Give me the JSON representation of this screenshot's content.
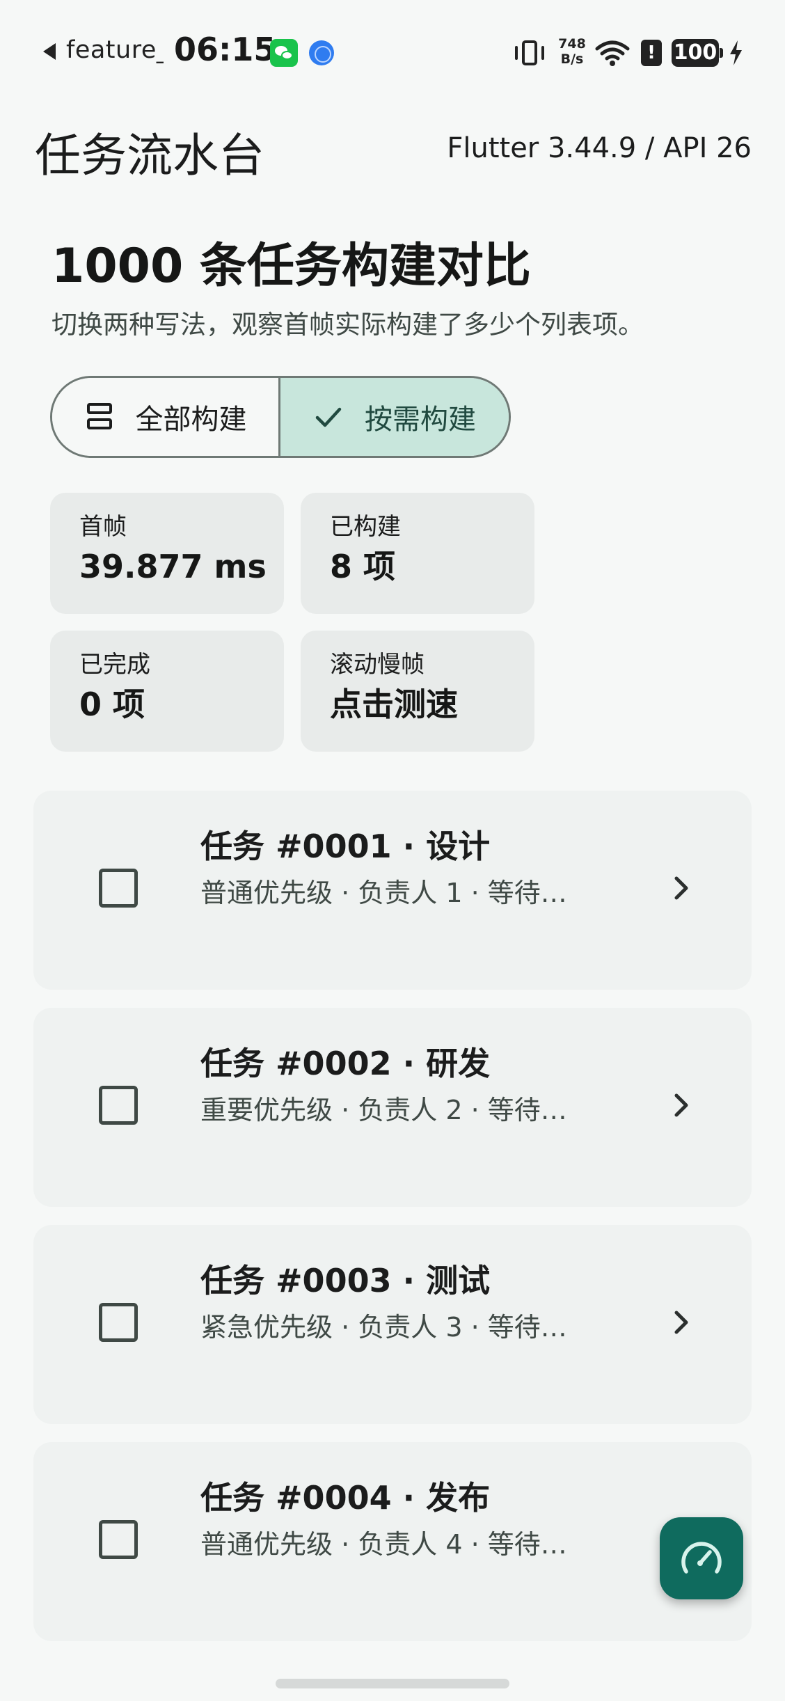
{
  "status_bar": {
    "app_label": "feature_c",
    "time": "06:15",
    "net_speed_top": "748",
    "net_speed_bottom": "B/s",
    "alert_glyph": "!",
    "battery": "100",
    "icons": [
      "back-arrow-icon",
      "wechat-icon",
      "globe-icon",
      "vibrate-icon",
      "wifi-icon",
      "alert-icon",
      "battery-icon",
      "charging-bolt-icon"
    ]
  },
  "appbar": {
    "title": "任务流水台",
    "version": "Flutter 3.44.9 / API 26"
  },
  "header": {
    "headline": "1000 条任务构建对比",
    "subtitle": "切换两种写法，观察首帧实际构建了多少个列表项。"
  },
  "segmented": {
    "options": [
      {
        "label": "全部构建",
        "selected": false,
        "icon": "view-agenda-icon"
      },
      {
        "label": "按需构建",
        "selected": true,
        "icon": "check-icon"
      }
    ]
  },
  "stats": [
    {
      "label": "首帧",
      "value": "39.877 ms"
    },
    {
      "label": "已构建",
      "value": "8 项"
    },
    {
      "label": "已完成",
      "value": "0 项"
    },
    {
      "label": "滚动慢帧",
      "value": "点击测速"
    }
  ],
  "tasks": [
    {
      "title": "任务 #0001 · 设计",
      "meta": "普通优先级 · 负责人 1 · 等待…",
      "done": false
    },
    {
      "title": "任务 #0002 · 研发",
      "meta": "重要优先级 · 负责人 2 · 等待…",
      "done": false
    },
    {
      "title": "任务 #0003 · 测试",
      "meta": "紧急优先级 · 负责人 3 · 等待…",
      "done": false
    },
    {
      "title": "任务 #0004 · 发布",
      "meta": "普通优先级 · 负责人 4 · 等待…",
      "done": false
    }
  ],
  "fab": {
    "icon": "speedometer-icon"
  },
  "colors": {
    "background": "#f6f8f7",
    "card": "#e8ebea",
    "task_card": "#eff2f1",
    "selected_segment": "#c8e6dc",
    "fab": "#0f6b5e",
    "text_secondary": "#3f4945"
  }
}
